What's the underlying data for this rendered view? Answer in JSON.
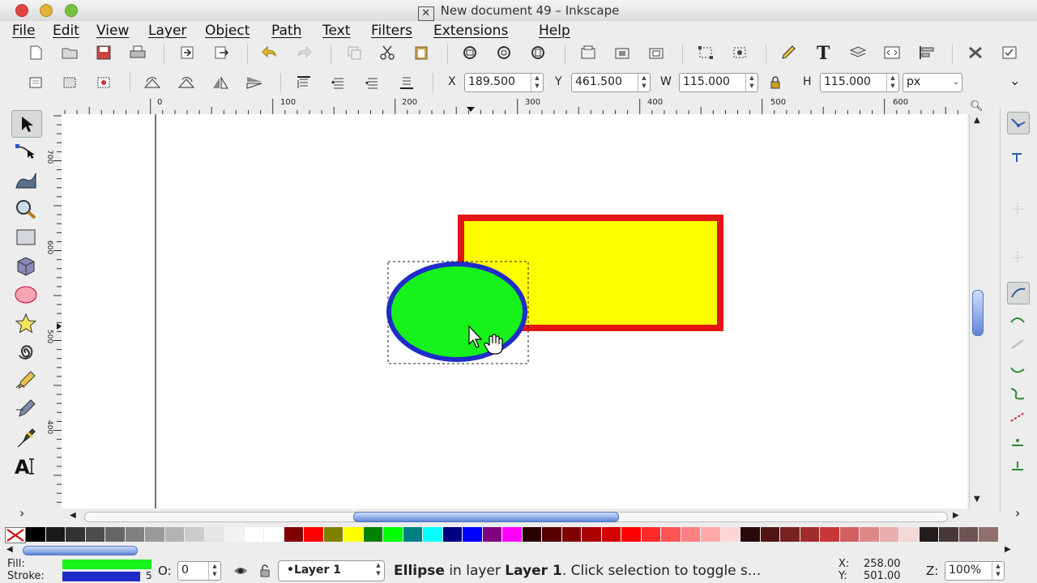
{
  "window": {
    "title": "New document 49 – Inkscape",
    "title_icon": "x-window-icon"
  },
  "menu": [
    "File",
    "Edit",
    "View",
    "Layer",
    "Object",
    "Path",
    "Text",
    "Filters",
    "Extensions",
    "Help"
  ],
  "toolbar_icons": [
    "new-document-icon",
    "open-icon",
    "save-icon",
    "print-icon",
    "import-icon",
    "export-icon",
    "undo-icon",
    "redo-icon",
    "duplicate-icon",
    "cut-icon",
    "paste-icon",
    "zoom-selection-icon",
    "zoom-drawing-icon",
    "zoom-page-icon",
    "group-icon",
    "clone-icon",
    "unlink-clone-icon",
    "node-editor-icon",
    "xml-editor-icon",
    "fill-stroke-icon",
    "text-tool-icon",
    "layers-icon",
    "align-icon",
    "xml-icon",
    "preferences-icon",
    "document-properties-icon"
  ],
  "select_toolbar": {
    "x_label": "X",
    "x_value": "189.500",
    "y_label": "Y",
    "y_value": "461.500",
    "w_label": "W",
    "w_value": "115.000",
    "h_label": "H",
    "h_value": "115.000",
    "unit": "px"
  },
  "ruler": {
    "h_labels": [
      "0",
      "100",
      "200",
      "300",
      "400",
      "500",
      "600"
    ],
    "v_labels": [
      "700",
      "600",
      "500",
      "400"
    ]
  },
  "tools": [
    "selector-tool-icon",
    "node-tool-icon",
    "tweak-tool-icon",
    "zoom-tool-icon",
    "rectangle-tool-icon",
    "3d-box-tool-icon",
    "ellipse-tool-icon",
    "star-tool-icon",
    "spiral-tool-icon",
    "pencil-tool-icon",
    "pen-tool-icon",
    "calligraphy-tool-icon",
    "text-tool-icon"
  ],
  "shapes": {
    "rect_fill": "#ffff00",
    "rect_stroke": "#e31515",
    "ellipse_fill": "#17f21a",
    "ellipse_stroke": "#1f2cc9"
  },
  "palette_colors": [
    "#000000",
    "#1a1a1a",
    "#333333",
    "#4d4d4d",
    "#666666",
    "#808080",
    "#999999",
    "#b3b3b3",
    "#cccccc",
    "#e6e6e6",
    "#f2f2f2",
    "#ffffff",
    "#ffffff",
    "#800000",
    "#ff0000",
    "#808000",
    "#ffff00",
    "#008000",
    "#00ff00",
    "#008080",
    "#00ffff",
    "#000080",
    "#0000ff",
    "#800080",
    "#ff00ff",
    "#2b0000",
    "#550000",
    "#800000",
    "#aa0000",
    "#d40000",
    "#ff0000",
    "#ff2a2a",
    "#ff5555",
    "#ff8080",
    "#ffaaaa",
    "#ffd5d5",
    "#280b0b",
    "#501616",
    "#782121",
    "#a02c2c",
    "#c83737",
    "#d35f5f",
    "#de8787",
    "#e9afaf",
    "#f4d7d7",
    "#241c1c",
    "#483737",
    "#6c5353",
    "#916f6f"
  ],
  "status": {
    "fill_label": "Fill:",
    "stroke_label": "Stroke:",
    "fill_color": "#17f21a",
    "stroke_color": "#1f2cc9",
    "stroke_width": "5",
    "opacity_label": "O:",
    "opacity_value": "0",
    "layer": "•Layer 1",
    "message_bold1": "Ellipse",
    "message_mid": " in layer ",
    "message_bold2": "Layer 1",
    "message_end": ". Click selection to toggle s...",
    "x_label": "X:",
    "x_value": "258.00",
    "y_label": "Y:",
    "y_value": "501.00",
    "zoom_label": "Z:",
    "zoom_value": "100%"
  }
}
